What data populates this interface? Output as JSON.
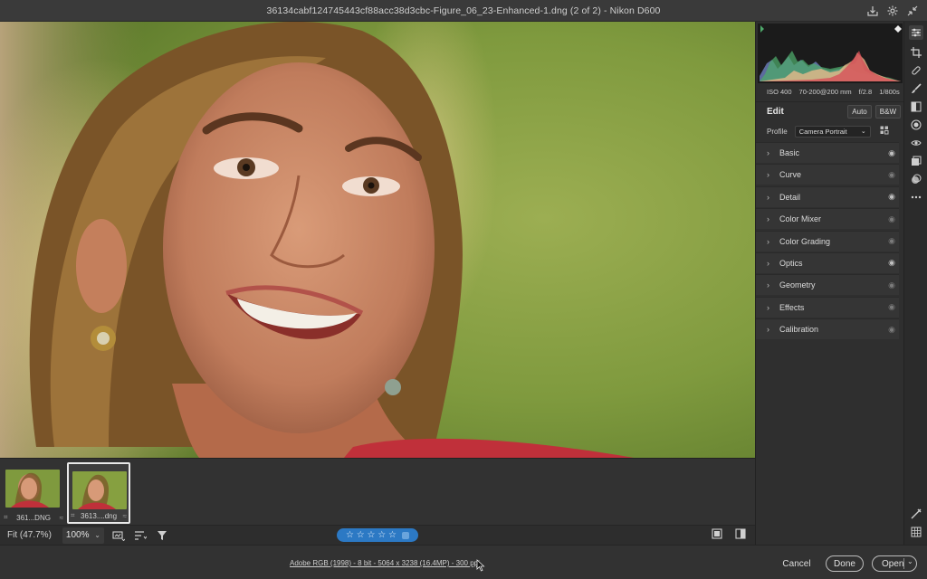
{
  "window": {
    "title": "36134cabf124745443cf88acc38d3cbc-Figure_06_23-Enhanced-1.dng (2 of 2)  -  Nikon D600"
  },
  "filmstrip": {
    "items": [
      {
        "label": "361...DNG",
        "selected": false
      },
      {
        "label": "3613....dng",
        "selected": true
      }
    ]
  },
  "bottombar": {
    "zoom_fit": "Fit (47.7%)",
    "zoom_value": "100%",
    "rating_stars": "☆ ☆ ☆ ☆ ☆"
  },
  "footer": {
    "workflow_link": "Adobe RGB (1998) - 8 bit - 5064 x 3238 (16.4MP) - 300 ppi",
    "cancel": "Cancel",
    "done": "Done",
    "open": "Open"
  },
  "panel": {
    "exif": {
      "iso": "ISO 400",
      "lens": "70-200@200 mm",
      "aperture": "f/2.8",
      "shutter": "1/800s"
    },
    "edit_label": "Edit",
    "auto_label": "Auto",
    "bw_label": "B&W",
    "profile_label": "Profile",
    "profile_value": "Camera Portrait",
    "sections": [
      {
        "name": "Basic",
        "eye": "on"
      },
      {
        "name": "Curve",
        "eye": "off"
      },
      {
        "name": "Detail",
        "eye": "on"
      },
      {
        "name": "Color Mixer",
        "eye": "off"
      },
      {
        "name": "Color Grading",
        "eye": "off"
      },
      {
        "name": "Optics",
        "eye": "on"
      },
      {
        "name": "Geometry",
        "eye": "off"
      },
      {
        "name": "Effects",
        "eye": "off"
      },
      {
        "name": "Calibration",
        "eye": "off"
      }
    ]
  },
  "toolstrip": {
    "tools": [
      "edit-icon",
      "crop-icon",
      "healing-icon",
      "brush-icon",
      "linear-gradient-icon",
      "radial-gradient-icon",
      "red-eye-icon",
      "snapshots-icon",
      "presets-icon",
      "more-icon",
      "sampler-icon",
      "grid-icon"
    ]
  }
}
